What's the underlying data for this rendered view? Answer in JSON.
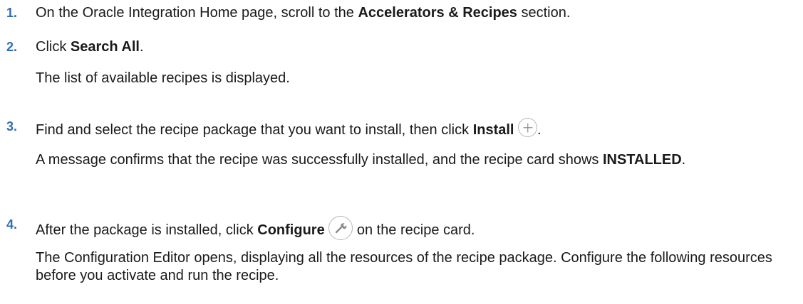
{
  "steps": [
    {
      "num": "1.",
      "pre": "On the Oracle Integration Home page, scroll to the ",
      "bold": "Accelerators & Recipes",
      "post": " section."
    },
    {
      "num": "2.",
      "pre": "Click ",
      "bold": "Search All",
      "post": ".",
      "result": "The list of available recipes is displayed."
    },
    {
      "num": "3.",
      "pre": "Find and select the recipe package that you want to install, then click ",
      "bold": "Install",
      "icon": "plus-circle-icon",
      "post": ".",
      "result_pre": "A message confirms that the recipe was successfully installed, and the recipe card shows ",
      "result_bold": "INSTALLED",
      "result_post": "."
    },
    {
      "num": "4.",
      "pre": "After the package is installed, click ",
      "bold": "Configure",
      "icon": "wrench-circle-icon",
      "post": " on the recipe card.",
      "result": "The Configuration Editor opens, displaying all the resources of the recipe package. Configure the following resources before you activate and run the recipe."
    }
  ]
}
